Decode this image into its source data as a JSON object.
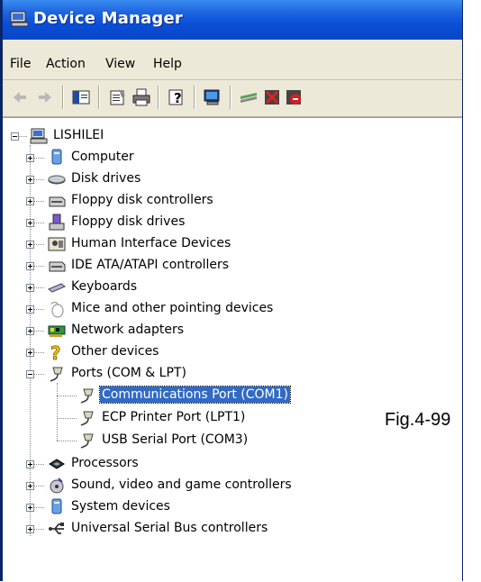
{
  "window": {
    "title": "Device Manager"
  },
  "menu": [
    "File",
    "Action",
    "View",
    "Help"
  ],
  "toolbar": {
    "icons": [
      "back-arrow-icon",
      "forward-arrow-icon",
      "show-hide-console-tree-icon",
      "properties-icon",
      "print-icon",
      "help-icon",
      "scan-hardware-icon",
      "update-driver-icon",
      "uninstall-icon",
      "disable-icon"
    ]
  },
  "tree": {
    "root": {
      "label": "LISHILEI",
      "expanded": true
    },
    "items": [
      {
        "label": "Computer",
        "icon": "computer-icon",
        "expanded": false
      },
      {
        "label": "Disk drives",
        "icon": "disk-drive-icon",
        "expanded": false
      },
      {
        "label": "Floppy disk controllers",
        "icon": "floppy-controller-icon",
        "expanded": false
      },
      {
        "label": "Floppy disk drives",
        "icon": "floppy-drive-icon",
        "expanded": false
      },
      {
        "label": "Human Interface Devices",
        "icon": "hid-icon",
        "expanded": false
      },
      {
        "label": "IDE ATA/ATAPI controllers",
        "icon": "ide-controller-icon",
        "expanded": false
      },
      {
        "label": "Keyboards",
        "icon": "keyboard-icon",
        "expanded": false
      },
      {
        "label": "Mice and other pointing devices",
        "icon": "mouse-icon",
        "expanded": false
      },
      {
        "label": "Network adapters",
        "icon": "network-adapter-icon",
        "expanded": false
      },
      {
        "label": "Other devices",
        "icon": "unknown-device-icon",
        "expanded": false
      },
      {
        "label": "Ports (COM & LPT)",
        "icon": "port-icon",
        "expanded": true,
        "children": [
          {
            "label": "Communications Port (COM1)",
            "icon": "port-icon",
            "selected": true
          },
          {
            "label": "ECP Printer Port (LPT1)",
            "icon": "port-icon"
          },
          {
            "label": "USB Serial Port (COM3)",
            "icon": "port-icon"
          }
        ]
      },
      {
        "label": "Processors",
        "icon": "processor-icon",
        "expanded": false
      },
      {
        "label": "Sound, video and game controllers",
        "icon": "sound-icon",
        "expanded": false
      },
      {
        "label": "System devices",
        "icon": "system-device-icon",
        "expanded": false
      },
      {
        "label": "Universal Serial Bus controllers",
        "icon": "usb-icon",
        "expanded": false
      }
    ]
  },
  "figure_label": "Fig.4-99"
}
